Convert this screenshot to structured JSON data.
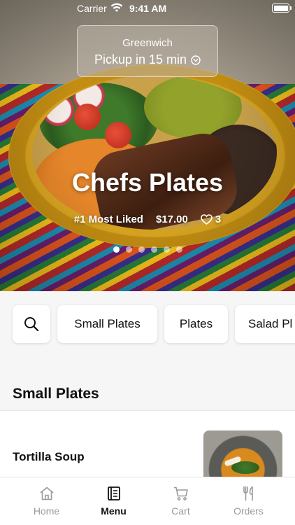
{
  "status_bar": {
    "carrier": "Carrier",
    "time": "9:41 AM"
  },
  "pickup": {
    "location": "Greenwich",
    "eta": "Pickup in 15 min"
  },
  "hero": {
    "title": "Chefs Plates",
    "rank": "#1 Most Liked",
    "price": "$17.00",
    "likes": "3",
    "page_count": 6,
    "active_page": 1
  },
  "categories": [
    "Small Plates",
    "Plates",
    "Salad Pl"
  ],
  "section": {
    "title": "Small Plates",
    "items": [
      {
        "name": "Tortilla Soup"
      }
    ]
  },
  "tabs": [
    {
      "label": "Home",
      "icon": "home-icon",
      "active": false
    },
    {
      "label": "Menu",
      "icon": "menu-book-icon",
      "active": true
    },
    {
      "label": "Cart",
      "icon": "cart-icon",
      "active": false
    },
    {
      "label": "Orders",
      "icon": "fork-knife-icon",
      "active": false
    }
  ]
}
